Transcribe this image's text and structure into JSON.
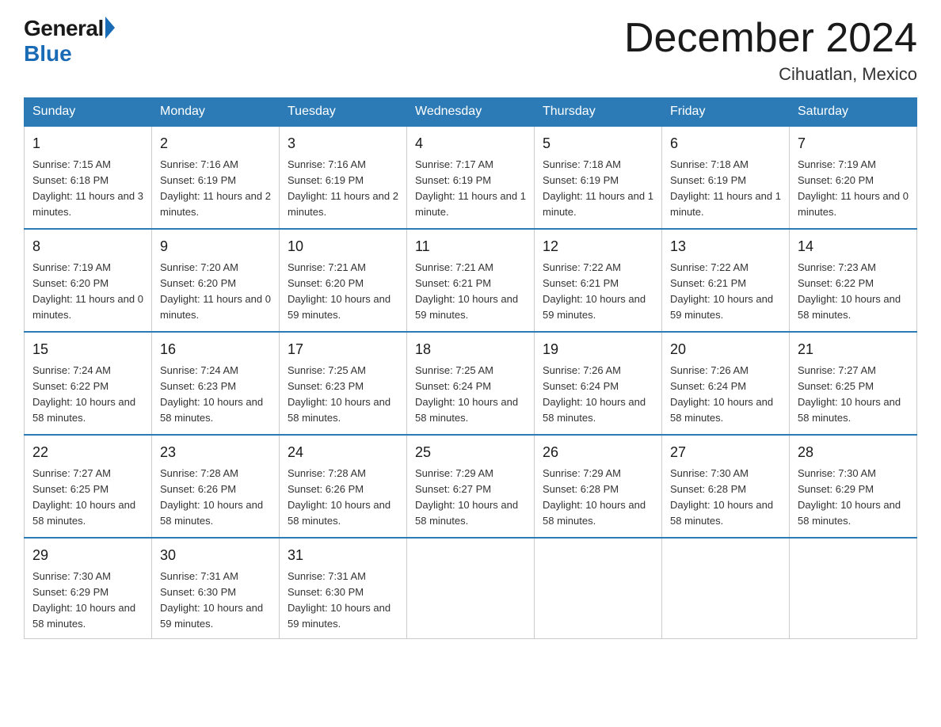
{
  "header": {
    "logo_general": "General",
    "logo_blue": "Blue",
    "month_title": "December 2024",
    "location": "Cihuatlan, Mexico"
  },
  "days_of_week": [
    "Sunday",
    "Monday",
    "Tuesday",
    "Wednesday",
    "Thursday",
    "Friday",
    "Saturday"
  ],
  "weeks": [
    [
      {
        "day": "1",
        "sunrise": "7:15 AM",
        "sunset": "6:18 PM",
        "daylight": "11 hours and 3 minutes."
      },
      {
        "day": "2",
        "sunrise": "7:16 AM",
        "sunset": "6:19 PM",
        "daylight": "11 hours and 2 minutes."
      },
      {
        "day": "3",
        "sunrise": "7:16 AM",
        "sunset": "6:19 PM",
        "daylight": "11 hours and 2 minutes."
      },
      {
        "day": "4",
        "sunrise": "7:17 AM",
        "sunset": "6:19 PM",
        "daylight": "11 hours and 1 minute."
      },
      {
        "day": "5",
        "sunrise": "7:18 AM",
        "sunset": "6:19 PM",
        "daylight": "11 hours and 1 minute."
      },
      {
        "day": "6",
        "sunrise": "7:18 AM",
        "sunset": "6:19 PM",
        "daylight": "11 hours and 1 minute."
      },
      {
        "day": "7",
        "sunrise": "7:19 AM",
        "sunset": "6:20 PM",
        "daylight": "11 hours and 0 minutes."
      }
    ],
    [
      {
        "day": "8",
        "sunrise": "7:19 AM",
        "sunset": "6:20 PM",
        "daylight": "11 hours and 0 minutes."
      },
      {
        "day": "9",
        "sunrise": "7:20 AM",
        "sunset": "6:20 PM",
        "daylight": "11 hours and 0 minutes."
      },
      {
        "day": "10",
        "sunrise": "7:21 AM",
        "sunset": "6:20 PM",
        "daylight": "10 hours and 59 minutes."
      },
      {
        "day": "11",
        "sunrise": "7:21 AM",
        "sunset": "6:21 PM",
        "daylight": "10 hours and 59 minutes."
      },
      {
        "day": "12",
        "sunrise": "7:22 AM",
        "sunset": "6:21 PM",
        "daylight": "10 hours and 59 minutes."
      },
      {
        "day": "13",
        "sunrise": "7:22 AM",
        "sunset": "6:21 PM",
        "daylight": "10 hours and 59 minutes."
      },
      {
        "day": "14",
        "sunrise": "7:23 AM",
        "sunset": "6:22 PM",
        "daylight": "10 hours and 58 minutes."
      }
    ],
    [
      {
        "day": "15",
        "sunrise": "7:24 AM",
        "sunset": "6:22 PM",
        "daylight": "10 hours and 58 minutes."
      },
      {
        "day": "16",
        "sunrise": "7:24 AM",
        "sunset": "6:23 PM",
        "daylight": "10 hours and 58 minutes."
      },
      {
        "day": "17",
        "sunrise": "7:25 AM",
        "sunset": "6:23 PM",
        "daylight": "10 hours and 58 minutes."
      },
      {
        "day": "18",
        "sunrise": "7:25 AM",
        "sunset": "6:24 PM",
        "daylight": "10 hours and 58 minutes."
      },
      {
        "day": "19",
        "sunrise": "7:26 AM",
        "sunset": "6:24 PM",
        "daylight": "10 hours and 58 minutes."
      },
      {
        "day": "20",
        "sunrise": "7:26 AM",
        "sunset": "6:24 PM",
        "daylight": "10 hours and 58 minutes."
      },
      {
        "day": "21",
        "sunrise": "7:27 AM",
        "sunset": "6:25 PM",
        "daylight": "10 hours and 58 minutes."
      }
    ],
    [
      {
        "day": "22",
        "sunrise": "7:27 AM",
        "sunset": "6:25 PM",
        "daylight": "10 hours and 58 minutes."
      },
      {
        "day": "23",
        "sunrise": "7:28 AM",
        "sunset": "6:26 PM",
        "daylight": "10 hours and 58 minutes."
      },
      {
        "day": "24",
        "sunrise": "7:28 AM",
        "sunset": "6:26 PM",
        "daylight": "10 hours and 58 minutes."
      },
      {
        "day": "25",
        "sunrise": "7:29 AM",
        "sunset": "6:27 PM",
        "daylight": "10 hours and 58 minutes."
      },
      {
        "day": "26",
        "sunrise": "7:29 AM",
        "sunset": "6:28 PM",
        "daylight": "10 hours and 58 minutes."
      },
      {
        "day": "27",
        "sunrise": "7:30 AM",
        "sunset": "6:28 PM",
        "daylight": "10 hours and 58 minutes."
      },
      {
        "day": "28",
        "sunrise": "7:30 AM",
        "sunset": "6:29 PM",
        "daylight": "10 hours and 58 minutes."
      }
    ],
    [
      {
        "day": "29",
        "sunrise": "7:30 AM",
        "sunset": "6:29 PM",
        "daylight": "10 hours and 58 minutes."
      },
      {
        "day": "30",
        "sunrise": "7:31 AM",
        "sunset": "6:30 PM",
        "daylight": "10 hours and 59 minutes."
      },
      {
        "day": "31",
        "sunrise": "7:31 AM",
        "sunset": "6:30 PM",
        "daylight": "10 hours and 59 minutes."
      },
      null,
      null,
      null,
      null
    ]
  ],
  "labels": {
    "sunrise_prefix": "Sunrise: ",
    "sunset_prefix": "Sunset: ",
    "daylight_prefix": "Daylight: "
  }
}
